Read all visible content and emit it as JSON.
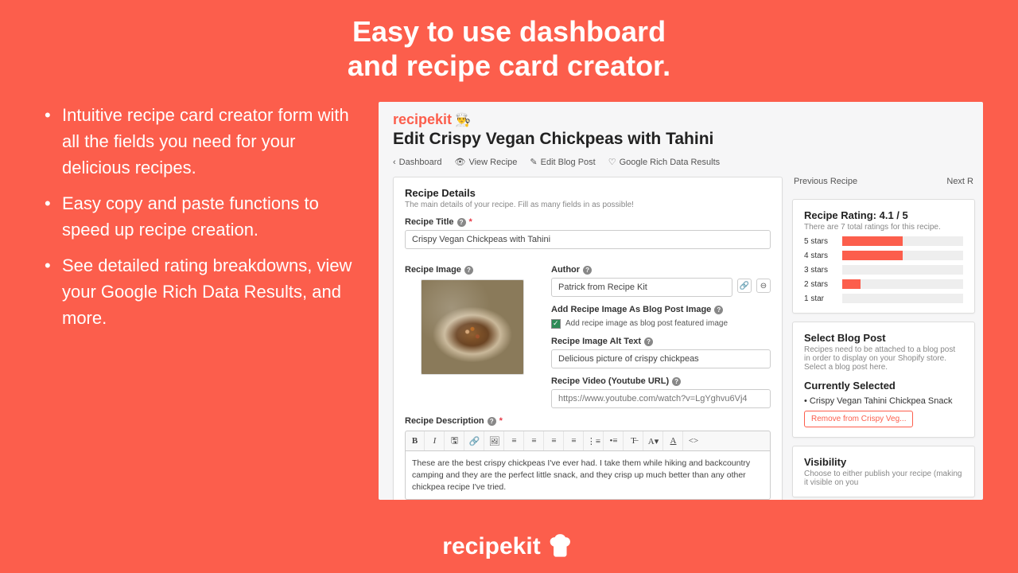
{
  "hero": {
    "line1": "Easy to use dashboard",
    "line2": "and recipe card creator."
  },
  "bullets": [
    "Intuitive recipe card creator form with all the fields you need for your delicious recipes.",
    "Easy copy and paste functions to speed up recipe creation.",
    "See detailed rating breakdowns, view your Google Rich Data Results, and more."
  ],
  "app": {
    "brand": "recipekit",
    "page_title": "Edit Crispy Vegan Chickpeas with Tahini",
    "crumbs": {
      "back": "Dashboard",
      "view": "View Recipe",
      "edit": "Edit Blog Post",
      "google": "Google Rich Data Results"
    },
    "nav": {
      "prev": "Previous Recipe",
      "next": "Next R"
    },
    "details": {
      "heading": "Recipe Details",
      "sub": "The main details of your recipe. Fill as many fields in as possible!",
      "title_label": "Recipe Title",
      "title_value": "Crispy Vegan Chickpeas with Tahini",
      "image_label": "Recipe Image",
      "author_label": "Author",
      "author_value": "Patrick from Recipe Kit",
      "add_image_label": "Add Recipe Image As Blog Post Image",
      "add_image_check": "Add recipe image as blog post featured image",
      "alt_label": "Recipe Image Alt Text",
      "alt_value": "Delicious picture of crispy chickpeas",
      "video_label": "Recipe Video (Youtube URL)",
      "video_placeholder": "https://www.youtube.com/watch?v=LgYghvu6Vj4",
      "desc_label": "Recipe Description",
      "desc_value": "These are the best crispy chickpeas I've ever had. I take them while hiking and backcountry camping and they are the perfect little snack, and they crisp up much better than any other chickpea recipe I've tried."
    },
    "rating": {
      "heading": "Recipe Rating: 4.1 / 5",
      "sub": "There are 7 total ratings for this recipe.",
      "rows": [
        {
          "label": "5 stars",
          "pct": 50
        },
        {
          "label": "4 stars",
          "pct": 50
        },
        {
          "label": "3 stars",
          "pct": 0
        },
        {
          "label": "2 stars",
          "pct": 15
        },
        {
          "label": "1 star",
          "pct": 0
        }
      ]
    },
    "blog": {
      "heading": "Select Blog Post",
      "sub": "Recipes need to be attached to a blog post in order to display on your Shopify store. Select a blog post here.",
      "current_heading": "Currently Selected",
      "current_item": "Crispy Vegan Tahini Chickpea Snack",
      "remove": "Remove from Crispy Veg..."
    },
    "visibility": {
      "heading": "Visibility",
      "sub": "Choose to either publish your recipe (making it visible on you"
    }
  },
  "footer_brand": "recipekit",
  "chart_data": {
    "type": "bar",
    "title": "Recipe Rating: 4.1 / 5",
    "categories": [
      "5 stars",
      "4 stars",
      "3 stars",
      "2 stars",
      "1 star"
    ],
    "values": [
      50,
      50,
      0,
      15,
      0
    ],
    "xlabel": "",
    "ylabel": "",
    "ylim": [
      0,
      100
    ]
  }
}
